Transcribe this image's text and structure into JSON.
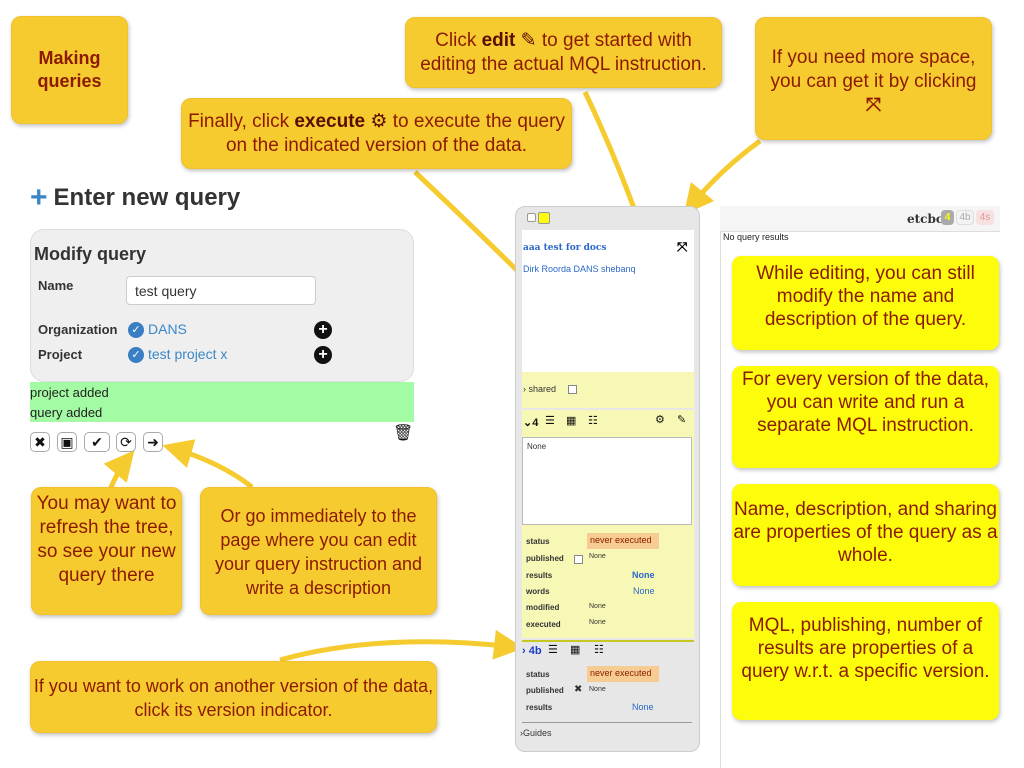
{
  "callouts": {
    "making": "Making queries",
    "edit_pre": "Click ",
    "edit_bold": "edit",
    "edit_post": " to get started with editing the actual MQL instruction.",
    "space_text": "If you need more space, you can get it by clicking",
    "exec_pre": "Finally, click ",
    "exec_bold": "execute",
    "exec_post": " to execute the query on the indicated version of the data.",
    "refresh": "You may want to refresh the tree, so see your new query there",
    "goimmediately": "Or go immediately to the page where you can edit your query instruction and write a description",
    "otherversion": "If you want to work on another version of the data, click its version indicator.",
    "editing": "While editing, you can still modify the name and description of the query.",
    "everyversion": "For every version of the data, you can write and run a separate MQL instruction.",
    "properties": "Name, description, and sharing are properties of the query as a whole.",
    "mql": "MQL, publishing, number of results are properties of a query w.r.t. a specific version."
  },
  "form": {
    "heading": "Enter new query",
    "card_title": "Modify query",
    "name_label": "Name",
    "name_value": "test query",
    "org_label": "Organization",
    "org_value": "DANS",
    "project_label": "Project",
    "project_value": "test project x",
    "messages": [
      "project added",
      "query added"
    ]
  },
  "panel": {
    "title": "aaa test for docs",
    "author": "Dirk Roorda DANS shebanq",
    "shared_label": "shared",
    "version4": "4",
    "textarea": "None",
    "v4_fields": {
      "status": "status",
      "status_val": "never executed",
      "published": "published",
      "published_val": "None",
      "results": "results",
      "results_val": "None",
      "words": "words",
      "words_val": "None",
      "modified": "modified",
      "modified_val": "None",
      "executed": "executed",
      "executed_val": "None"
    },
    "version4b": "4b",
    "v4b_fields": {
      "status": "status",
      "status_val": "never executed",
      "published": "published",
      "published_val": "None",
      "results": "results",
      "results_val": "None"
    },
    "guides": "Guides"
  },
  "results": {
    "label": "etcbc",
    "v1": "4",
    "v2": "4b",
    "v3": "4s",
    "none": "No query results"
  },
  "colors": {
    "callout": "#f6cb2f",
    "callout_yellow": "#fcfc0b",
    "message_green": "#a3fca3",
    "link_blue": "#3b87c6"
  }
}
